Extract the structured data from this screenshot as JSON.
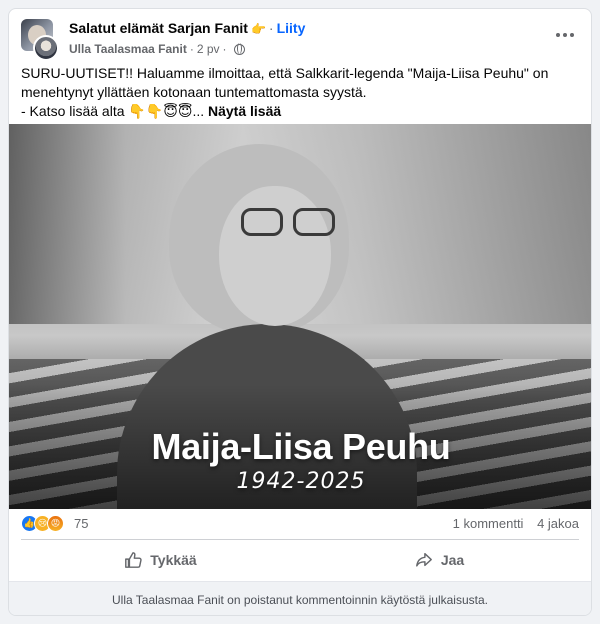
{
  "post": {
    "group_name": "Salatut elämät Sarjan Fanit",
    "group_emoji": "👉",
    "join_label": "Liity",
    "author": "Ulla Taalasmaa Fanit",
    "time": "2 pv",
    "text_lines": [
      "SURU-UUTISET!! Haluamme ilmoittaa, että Salkkarit-legenda \"Maija-Liisa Peuhu\" on",
      "menehtynyt yllättäen kotonaan tuntemattomasta syystä."
    ],
    "text_line3_prefix": "- Katso lisää alta 👇👇😇😇...",
    "see_more": "Näytä lisää"
  },
  "photo": {
    "name": "Maija-Liisa Peuhu",
    "years": "1942-2025"
  },
  "reactions": {
    "count": "75",
    "comments": "1 kommentti",
    "shares": "4 jakoa"
  },
  "actions": {
    "like": "Tykkää",
    "share": "Jaa"
  },
  "notice": "Ulla Taalasmaa Fanit on poistanut kommentoinnin käytöstä julkaisusta.",
  "colors": {
    "link": "#0866ff",
    "secondary_text": "#65676b",
    "like_reaction": "#1877f2"
  }
}
